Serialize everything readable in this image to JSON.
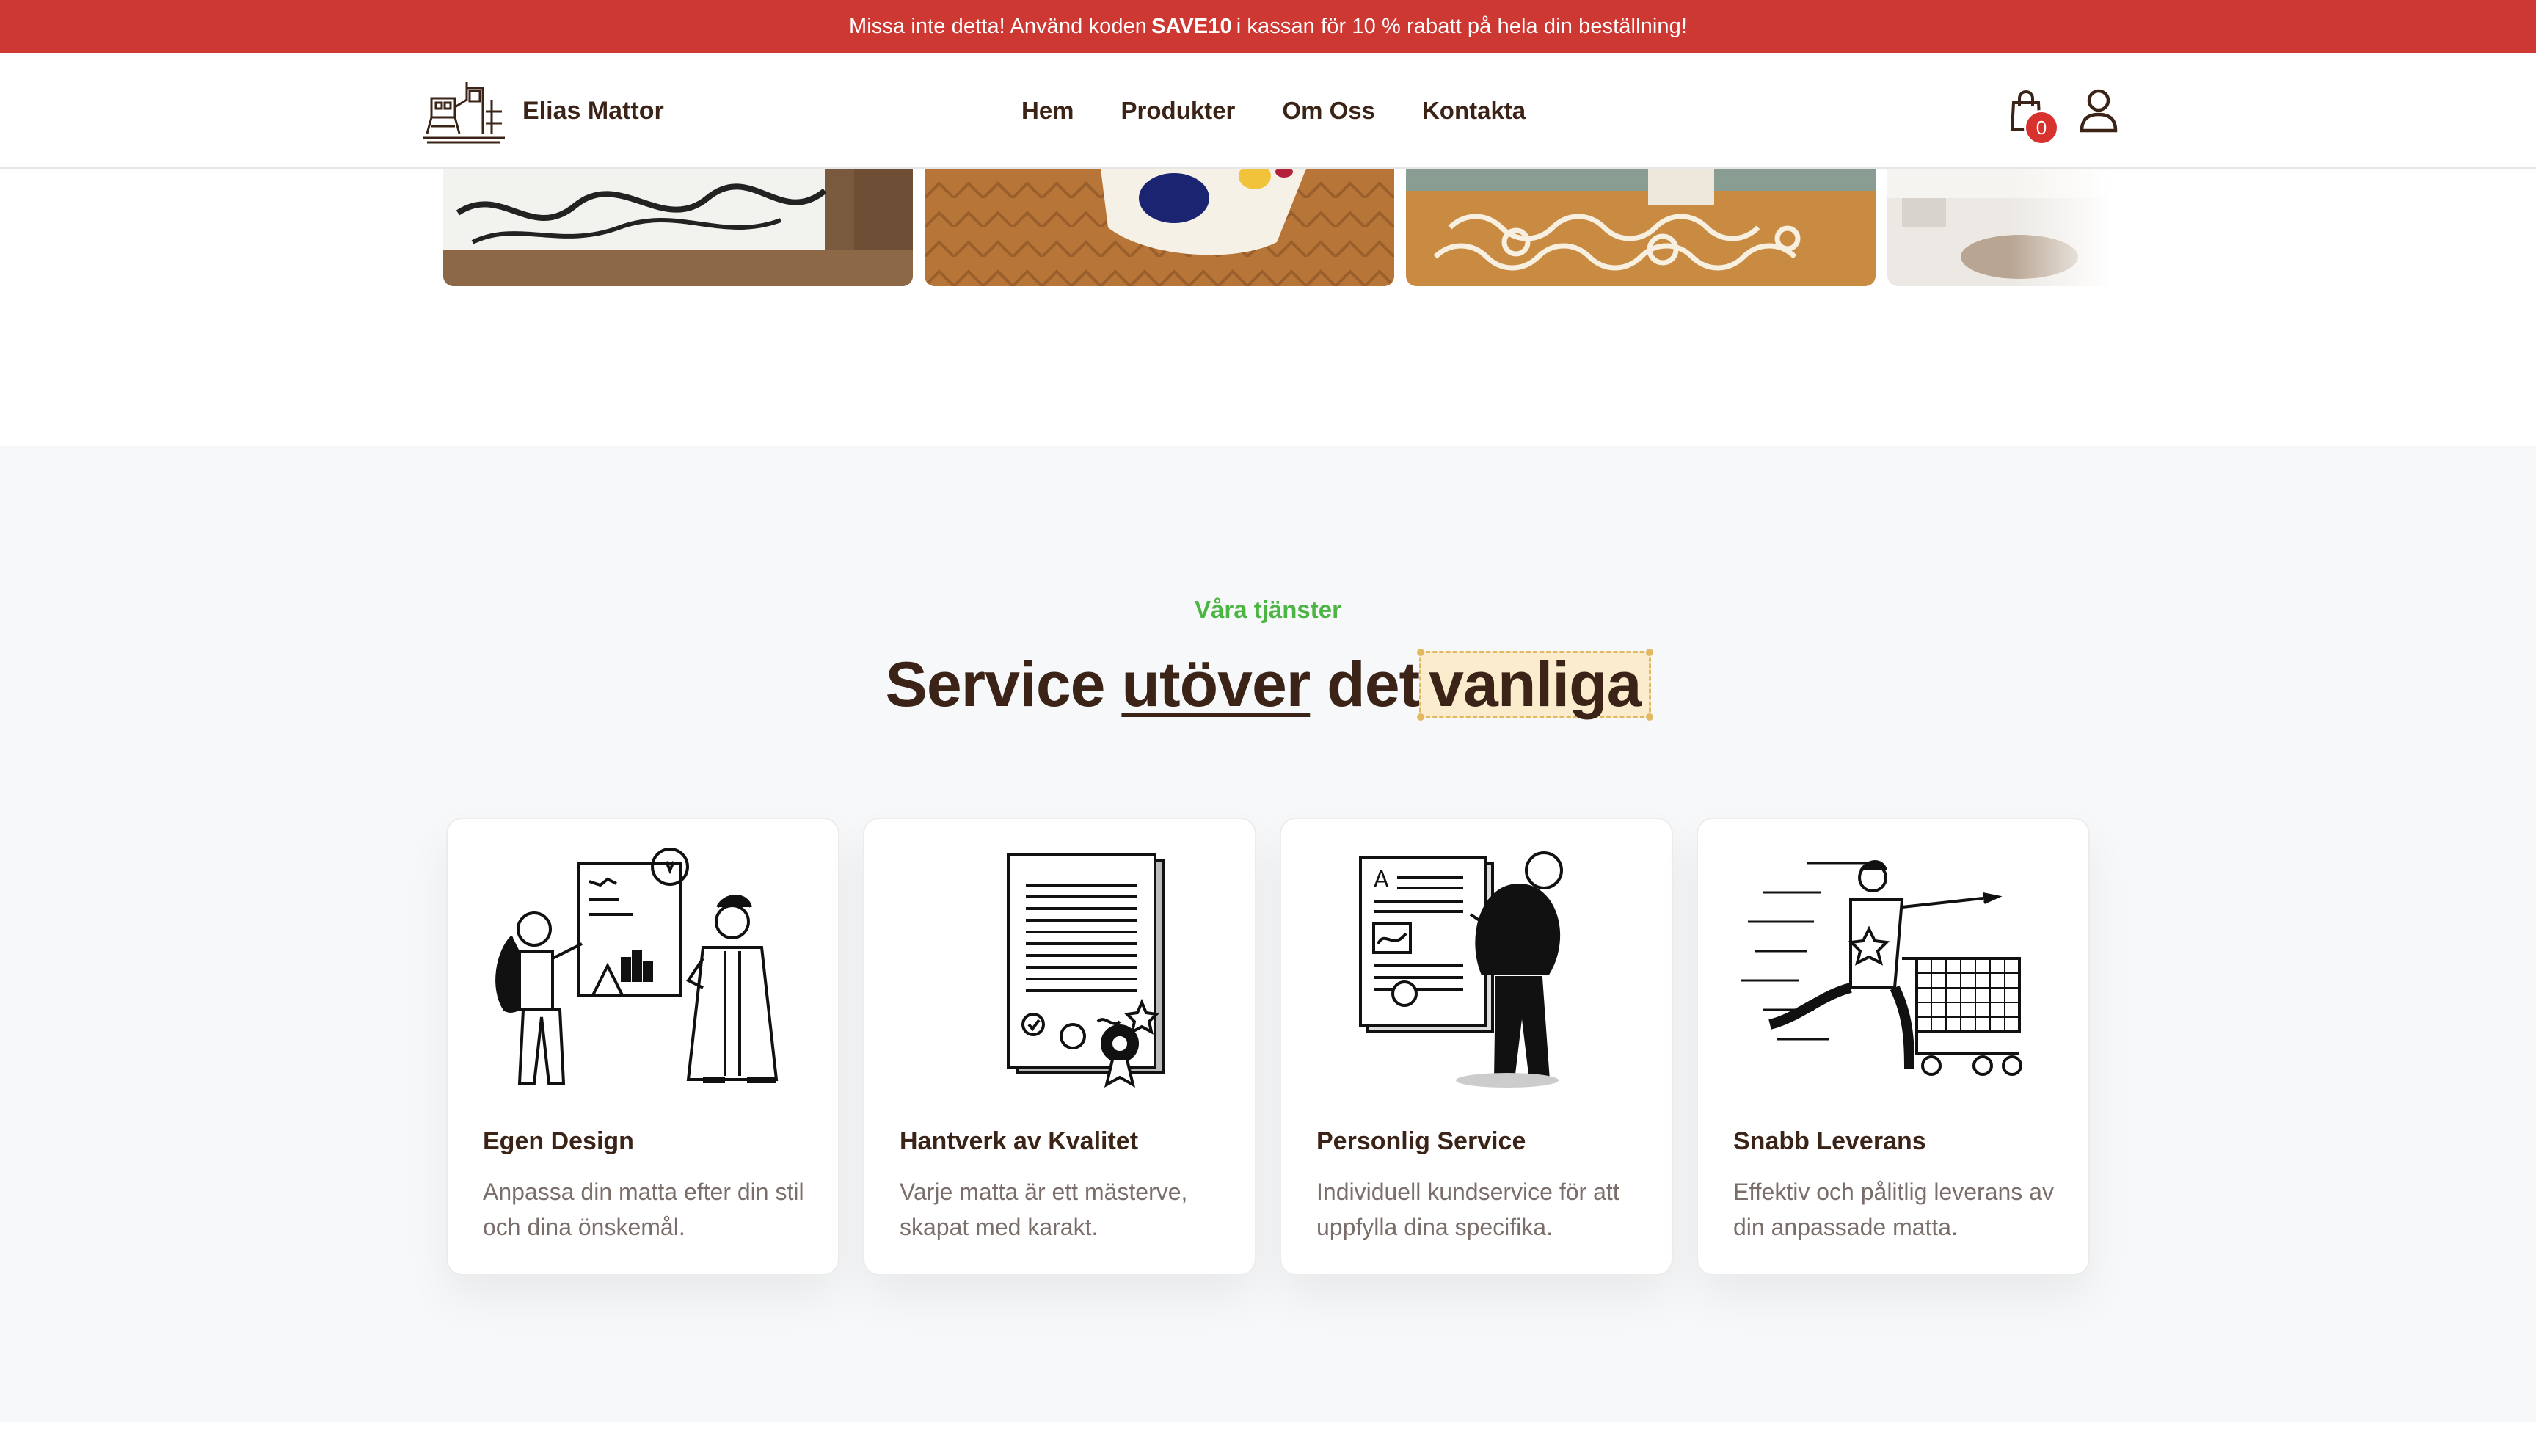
{
  "promo": {
    "prefix": "Missa inte detta! Använd koden",
    "code": "SAVE10",
    "suffix": "i kassan för 10 % rabatt på hela din beställning!"
  },
  "header": {
    "brand": "Elias Mattor",
    "nav": [
      "Hem",
      "Produkter",
      "Om Oss",
      "Kontakta"
    ],
    "cart_count": "0",
    "icons": [
      "logo-sewing-machine-icon",
      "shopping-bag-icon",
      "user-icon"
    ]
  },
  "carousel": {
    "slides": [
      "rug-black-white-lines",
      "rug-colorful-blobs",
      "rug-orange-pattern",
      "rug-partial"
    ]
  },
  "services": {
    "eyebrow": "Våra tjänster",
    "headline": {
      "part1": "Service",
      "underlined": "utöver",
      "part2": "det",
      "highlighted": "vanliga"
    },
    "cards": [
      {
        "title": "Egen Design",
        "description": "Anpassa din matta efter din stil och dina önskemål.",
        "icon": "design-team-illustration"
      },
      {
        "title": "Hantverk av Kvalitet",
        "description": "Varje matta är ett mästerve, skapat med karakt.",
        "icon": "certificate-illustration"
      },
      {
        "title": "Personlig Service",
        "description": "Individuell kundservice för att uppfylla dina specifika.",
        "icon": "personal-service-illustration"
      },
      {
        "title": "Snabb Leverans",
        "description": "Effektiv och pålitlig leverans av din anpassade matta.",
        "icon": "delivery-cart-illustration"
      }
    ]
  },
  "colors": {
    "promo_bg": "#cd3833",
    "brand_text": "#3b2417",
    "eyebrow_green": "#4cb543",
    "highlight_bg": "#fbeccd",
    "badge_red": "#d8322f"
  }
}
